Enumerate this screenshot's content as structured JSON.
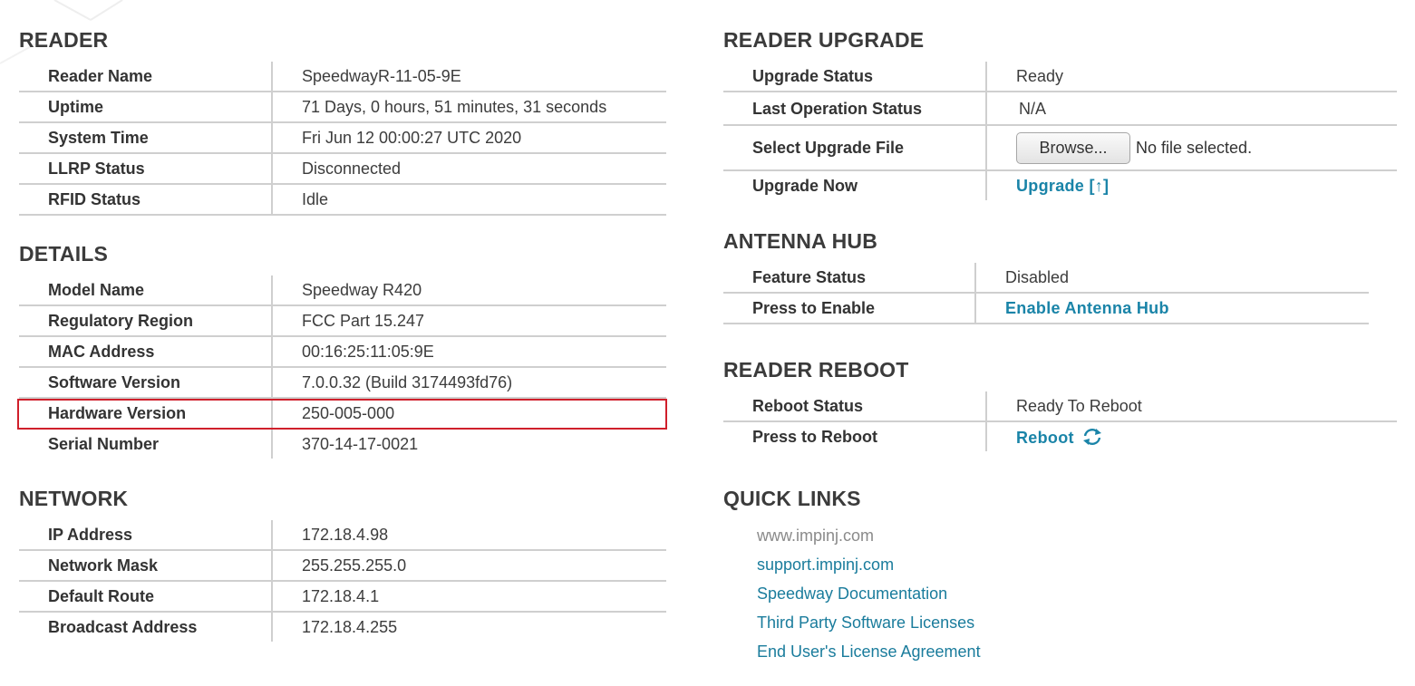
{
  "reader": {
    "title": "READER",
    "rows": [
      {
        "label": "Reader Name",
        "value": "SpeedwayR-11-05-9E"
      },
      {
        "label": "Uptime",
        "value": "71 Days, 0 hours, 51 minutes, 31 seconds"
      },
      {
        "label": "System Time",
        "value": "Fri Jun 12 00:00:27 UTC 2020"
      },
      {
        "label": "LLRP Status",
        "value": "Disconnected"
      },
      {
        "label": "RFID Status",
        "value": "Idle"
      }
    ]
  },
  "details": {
    "title": "DETAILS",
    "rows": [
      {
        "label": "Model Name",
        "value": "Speedway R420"
      },
      {
        "label": "Regulatory Region",
        "value": "FCC Part 15.247"
      },
      {
        "label": "MAC Address",
        "value": "00:16:25:11:05:9E"
      },
      {
        "label": "Software Version",
        "value": "7.0.0.32 (Build 3174493fd76)"
      },
      {
        "label": "Hardware Version",
        "value": "250-005-000"
      },
      {
        "label": "Serial Number",
        "value": "370-14-17-0021"
      }
    ]
  },
  "network": {
    "title": "NETWORK",
    "rows": [
      {
        "label": "IP Address",
        "value": "172.18.4.98"
      },
      {
        "label": "Network Mask",
        "value": "255.255.255.0"
      },
      {
        "label": "Default Route",
        "value": "172.18.4.1"
      },
      {
        "label": "Broadcast Address",
        "value": "172.18.4.255"
      }
    ]
  },
  "upgrade": {
    "title": "READER UPGRADE",
    "status_label": "Upgrade Status",
    "status_value": "Ready",
    "last_op_label": "Last Operation Status",
    "last_op_value": "N/A",
    "select_file_label": "Select Upgrade File",
    "browse_label": "Browse...",
    "no_file_text": "No file selected.",
    "upgrade_now_label": "Upgrade Now",
    "upgrade_link": "Upgrade",
    "upgrade_link_icon": "[↑]"
  },
  "antenna_hub": {
    "title": "ANTENNA HUB",
    "feature_label": "Feature Status",
    "feature_value": "Disabled",
    "enable_label": "Press to Enable",
    "enable_link": "Enable Antenna Hub"
  },
  "reboot": {
    "title": "READER REBOOT",
    "status_label": "Reboot Status",
    "status_value": "Ready To Reboot",
    "press_label": "Press to Reboot",
    "reboot_link": "Reboot"
  },
  "quick_links": {
    "title": "QUICK LINKS",
    "items": [
      "www.impinj.com",
      "support.impinj.com",
      "Speedway Documentation",
      "Third Party Software Licenses",
      "End User's License Agreement"
    ]
  },
  "colors": {
    "link": "#1a7c9c",
    "highlight_border": "#d01f2b",
    "divider": "#cfcfcf"
  }
}
